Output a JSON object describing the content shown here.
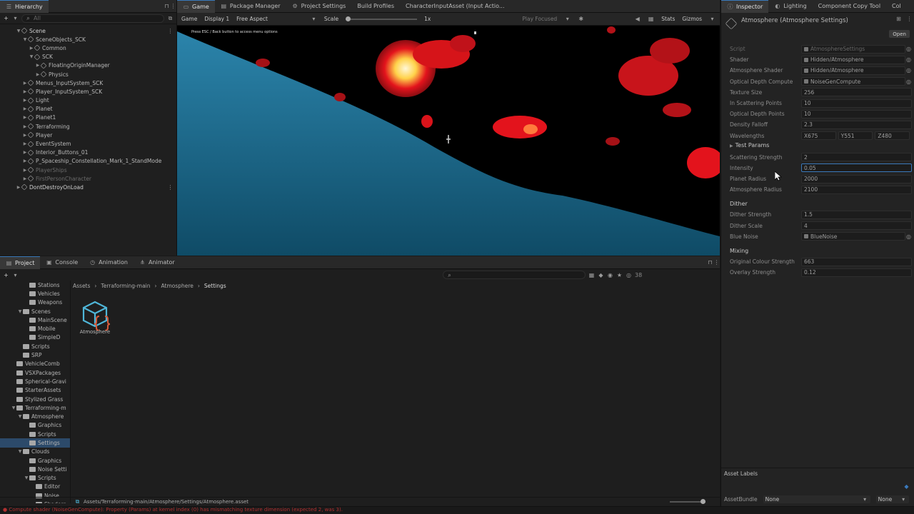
{
  "hierarchy": {
    "tab": "Hierarchy",
    "search_placeholder": "All",
    "rows": [
      {
        "label": "Scene",
        "indent": 0,
        "open": true,
        "kind": "scene"
      },
      {
        "label": "SceneObjects_SCK",
        "indent": 1,
        "open": true
      },
      {
        "label": "Common",
        "indent": 2
      },
      {
        "label": "SCK",
        "indent": 2,
        "open": true
      },
      {
        "label": "FloatingOriginManager",
        "indent": 3
      },
      {
        "label": "Physics",
        "indent": 3
      },
      {
        "label": "Menus_InputSystem_SCK",
        "indent": 1
      },
      {
        "label": "Player_InputSystem_SCK",
        "indent": 1
      },
      {
        "label": "Light",
        "indent": 1
      },
      {
        "label": "Planet",
        "indent": 1
      },
      {
        "label": "Planet1",
        "indent": 1
      },
      {
        "label": "Terraforming",
        "indent": 1
      },
      {
        "label": "Player",
        "indent": 1
      },
      {
        "label": "EventSystem",
        "indent": 1
      },
      {
        "label": "Interior_Buttons_01",
        "indent": 1
      },
      {
        "label": "P_Spaceship_Constellation_Mark_1_StandMode",
        "indent": 1
      },
      {
        "label": "PlayerShips",
        "indent": 1,
        "dim": true
      },
      {
        "label": "FirstPersonCharacter",
        "indent": 1,
        "dim": true
      },
      {
        "label": "DontDestroyOnLoad",
        "indent": 0,
        "kind": "scene"
      }
    ]
  },
  "game": {
    "tabs": [
      "Game",
      "Package Manager",
      "Project Settings",
      "Build Profiles",
      "CharacterInputAsset (Input Actio..."
    ],
    "toolbar": {
      "mode": "Game",
      "display": "Display 1",
      "aspect": "Free Aspect",
      "scale_label": "Scale",
      "scale_value": "1x",
      "play_focused": "Play Focused",
      "stats": "Stats",
      "gizmos": "Gizmos"
    },
    "overlay_text": "Press ESC / Back button to access menu options"
  },
  "project": {
    "tabs": [
      "Project",
      "Console",
      "Animation",
      "Animator"
    ],
    "breadcrumb": [
      "Assets",
      "Terraforming-main",
      "Atmosphere",
      "Settings"
    ],
    "count": "38",
    "tree": [
      {
        "label": "Stations",
        "indent": 3
      },
      {
        "label": "Vehicles",
        "indent": 3
      },
      {
        "label": "Weapons",
        "indent": 3
      },
      {
        "label": "Scenes",
        "indent": 2,
        "open": true
      },
      {
        "label": "MainScene",
        "indent": 3
      },
      {
        "label": "Mobile",
        "indent": 3
      },
      {
        "label": "SimpleD",
        "indent": 3
      },
      {
        "label": "Scripts",
        "indent": 2
      },
      {
        "label": "SRP",
        "indent": 2
      },
      {
        "label": "VehicleComb",
        "indent": 1
      },
      {
        "label": "VSXPackages",
        "indent": 1
      },
      {
        "label": "Spherical-Gravi",
        "indent": 1
      },
      {
        "label": "StarterAssets",
        "indent": 1
      },
      {
        "label": "Stylized Grass",
        "indent": 1
      },
      {
        "label": "Terraforming-m",
        "indent": 1,
        "open": true
      },
      {
        "label": "Atmosphere",
        "indent": 2,
        "open": true
      },
      {
        "label": "Graphics",
        "indent": 3
      },
      {
        "label": "Scripts",
        "indent": 3
      },
      {
        "label": "Settings",
        "indent": 3,
        "selected": true
      },
      {
        "label": "Clouds",
        "indent": 2,
        "open": true
      },
      {
        "label": "Graphics",
        "indent": 3
      },
      {
        "label": "Noise Setti",
        "indent": 3
      },
      {
        "label": "Scripts",
        "indent": 3,
        "open": true
      },
      {
        "label": "Editor",
        "indent": 4
      },
      {
        "label": "Noise",
        "indent": 4
      },
      {
        "label": "Shaders",
        "indent": 4
      }
    ],
    "asset": {
      "name": "Atmosphere"
    },
    "path": "Assets/Terraforming-main/Atmosphere/Settings/Atmosphere.asset"
  },
  "inspector": {
    "tabs": [
      "Inspector",
      "Lighting",
      "Component Copy Tool",
      "Col"
    ],
    "title": "Atmosphere (Atmosphere Settings)",
    "open_button": "Open",
    "fields": [
      {
        "label": "Script",
        "value": "AtmosphereSettings",
        "obj": true,
        "dim": true
      },
      {
        "label": "Shader",
        "value": "Hidden/Atmosphere",
        "obj": true
      },
      {
        "label": "Atmosphere Shader",
        "value": "Hidden/Atmosphere",
        "obj": true
      },
      {
        "label": "Optical Depth Compute",
        "value": "NoiseGenCompute",
        "obj": true
      },
      {
        "label": "Texture Size",
        "value": "256"
      },
      {
        "label": "In Scattering Points",
        "value": "10"
      },
      {
        "label": "Optical Depth Points",
        "value": "10"
      },
      {
        "label": "Density Falloff",
        "value": "2.3"
      }
    ],
    "wavelengths": {
      "label": "Wavelengths",
      "x": "675",
      "y": "551",
      "z": "480"
    },
    "test_params": {
      "header": "Test Params",
      "fields": [
        {
          "label": "Scattering Strength",
          "value": "2"
        },
        {
          "label": "Intensity",
          "value": "0.05",
          "focus": true
        },
        {
          "label": "Planet Radius",
          "value": "2000"
        },
        {
          "label": "Atmosphere Radius",
          "value": "2100"
        }
      ]
    },
    "dither": {
      "header": "Dither",
      "fields": [
        {
          "label": "Dither Strength",
          "value": "1.5"
        },
        {
          "label": "Dither Scale",
          "value": "4"
        },
        {
          "label": "Blue Noise",
          "value": "BlueNoise",
          "obj": true
        }
      ]
    },
    "mixing": {
      "header": "Mixing",
      "fields": [
        {
          "label": "Original Colour Strength",
          "value": "663"
        },
        {
          "label": "Overlay Strength",
          "value": "0.12"
        }
      ]
    },
    "asset_labels": "Asset Labels",
    "asset_bundle": {
      "label": "AssetBundle",
      "value": "None",
      "variant": "None"
    }
  },
  "status": {
    "text": "Compute shader (NoiseGenCompute): Property (Params) at kernel index (0) has mismatching texture dimension (expected 2, was 3)."
  },
  "colors": {
    "accent": "#3a79bb",
    "ocean": "#1f6a8c",
    "heat_red": "#e3131c",
    "heat_yellow": "#ffd24a"
  }
}
